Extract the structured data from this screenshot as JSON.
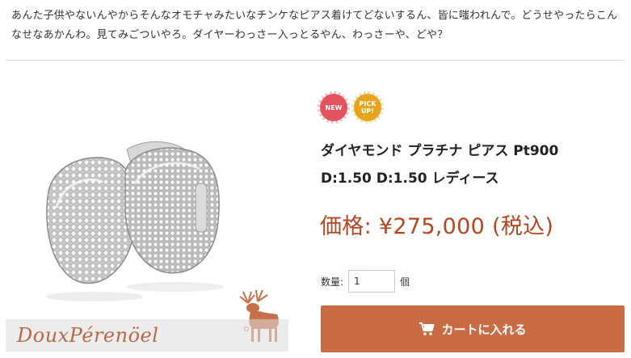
{
  "intro_text": "あんた子供やないんやからそんなオモチャみたいなチンケなピアス着けてどないするん、皆に嗤われんで。どうせやったらこんなせなあかんわ。見てみごついやろ。ダイヤーわっさー入っとるやん、わっさーや、どや？",
  "product": {
    "image_watermark": "DouxPérenöel",
    "badges": {
      "new": "NEW",
      "pick_up_line1": "PICK",
      "pick_up_line2": "UP!"
    },
    "title_line1": "ダイヤモンド プラチナ ピアス Pt900",
    "title_line2": "D:1.50 D:1.50 レディース",
    "price": "価格: ¥275,000 (税込)",
    "quantity_label": "数量:",
    "quantity_value": "1",
    "quantity_unit": "個",
    "cart_button_label": "カートに入れる",
    "cart_icon": "shopping-cart-icon"
  },
  "colors": {
    "price": "#b5461f",
    "cart_button": "#c96b45",
    "badge_new": "#e2535d",
    "badge_pick_up": "#e5a51f",
    "watermark": "#b5694a"
  }
}
